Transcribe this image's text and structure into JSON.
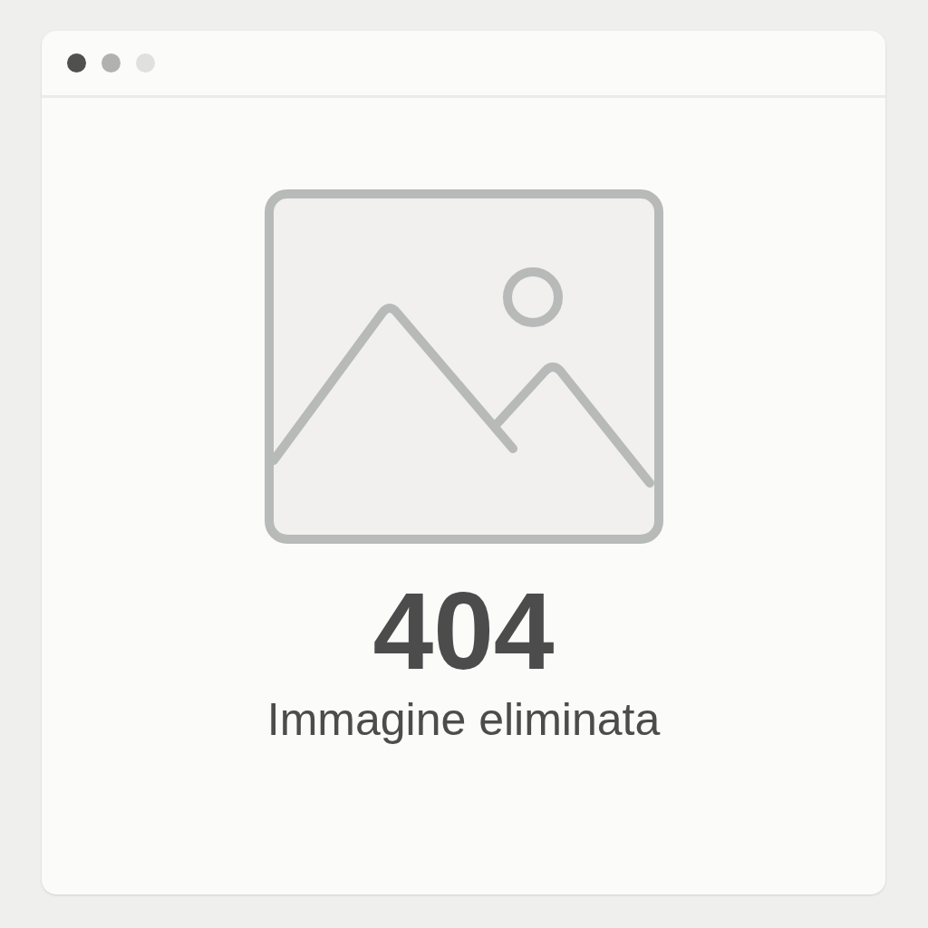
{
  "window": {
    "controls": [
      {
        "color": "#505050"
      },
      {
        "color": "#b0b2b1"
      },
      {
        "color": "#e0e0e0"
      }
    ]
  },
  "error": {
    "code": "404",
    "message": "Immagine eliminata"
  }
}
